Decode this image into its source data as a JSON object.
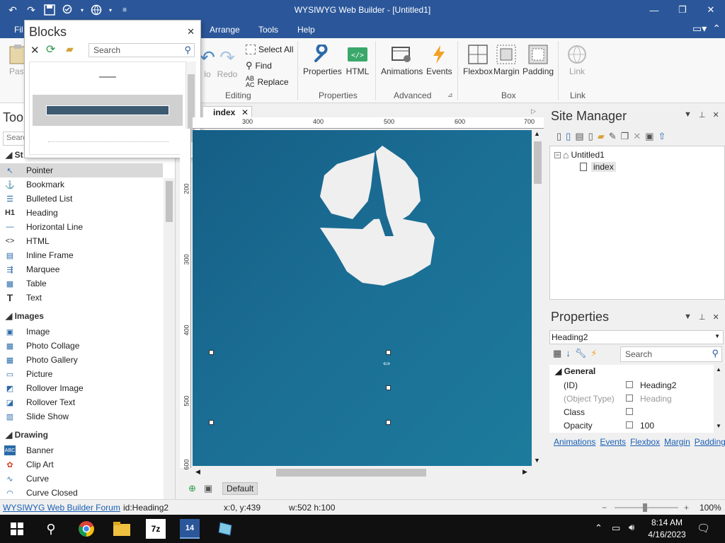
{
  "window": {
    "title": "WYSIWYG Web Builder - [Untitled1]",
    "qat_icons": [
      "undo-icon",
      "redo-icon",
      "save-icon",
      "preview-icon",
      "publish-icon",
      "customize-icon"
    ]
  },
  "menu": {
    "file_partial": "Fil",
    "arrange": "Arrange",
    "tools": "Tools",
    "help": "Help"
  },
  "ribbon": {
    "paste_partial": "Past",
    "undo_partial": "lo",
    "redo": "Redo",
    "select_all": "Select All",
    "find": "Find",
    "replace": "Replace",
    "editing_group": "Editing",
    "properties": "Properties",
    "html": "HTML",
    "properties_group": "Properties",
    "animations": "Animations",
    "events": "Events",
    "advanced_group": "Advanced",
    "flexbox": "Flexbox",
    "margin": "Margin",
    "padding": "Padding",
    "box_group": "Box",
    "link": "Link",
    "link_group": "Link"
  },
  "blocks": {
    "title": "Blocks",
    "search_placeholder": "Search"
  },
  "toolbox": {
    "title_partial": "Too",
    "search_partial": "Searc",
    "standard_partial": "St",
    "items_standard": [
      {
        "label": "Pointer",
        "icon": "pointer-icon"
      },
      {
        "label": "Bookmark",
        "icon": "anchor-icon"
      },
      {
        "label": "Bulleted List",
        "icon": "list-icon"
      },
      {
        "label": "Heading",
        "icon": "heading-icon"
      },
      {
        "label": "Horizontal Line",
        "icon": "line-icon"
      },
      {
        "label": "HTML",
        "icon": "code-icon"
      },
      {
        "label": "Inline Frame",
        "icon": "frame-icon"
      },
      {
        "label": "Marquee",
        "icon": "marquee-icon"
      },
      {
        "label": "Table",
        "icon": "table-icon"
      },
      {
        "label": "Text",
        "icon": "text-icon"
      }
    ],
    "images_label": "Images",
    "items_images": [
      {
        "label": "Image",
        "icon": "image-icon"
      },
      {
        "label": "Photo Collage",
        "icon": "collage-icon"
      },
      {
        "label": "Photo Gallery",
        "icon": "gallery-icon"
      },
      {
        "label": "Picture",
        "icon": "picture-icon"
      },
      {
        "label": "Rollover Image",
        "icon": "rollover-image-icon"
      },
      {
        "label": "Rollover Text",
        "icon": "rollover-text-icon"
      },
      {
        "label": "Slide Show",
        "icon": "slideshow-icon"
      }
    ],
    "drawing_label": "Drawing",
    "items_drawing": [
      {
        "label": "Banner",
        "icon": "banner-icon"
      },
      {
        "label": "Clip Art",
        "icon": "clipart-icon"
      },
      {
        "label": "Curve",
        "icon": "curve-icon"
      },
      {
        "label": "Curve Closed",
        "icon": "curve-closed-icon"
      }
    ]
  },
  "document": {
    "tab": "index",
    "ruler_h": [
      "300",
      "400",
      "500",
      "600",
      "700"
    ],
    "ruler_v": [
      "200",
      "300",
      "400",
      "500",
      "600"
    ],
    "layout_label": "Default"
  },
  "site_manager": {
    "title": "Site Manager",
    "root": "Untitled1",
    "page": "index"
  },
  "properties": {
    "title": "Properties",
    "selected": "Heading2",
    "search_placeholder": "Search",
    "category": "General",
    "rows": [
      {
        "key": "(ID)",
        "value": "Heading2"
      },
      {
        "key": "(Object Type)",
        "value": "Heading"
      },
      {
        "key": "Class",
        "value": ""
      },
      {
        "key": "Opacity",
        "value": "100"
      }
    ],
    "links": [
      "Animations",
      "Events",
      "Flexbox",
      "Margin",
      "Padding"
    ]
  },
  "statusbar": {
    "forum": "WYSIWYG Web Builder Forum",
    "id": "id:Heading2",
    "coords": "x:0, y:439",
    "size": "w:502 h:100",
    "zoom": "100%"
  },
  "taskbar": {
    "time": "8:14 AM",
    "date": "4/16/2023"
  },
  "colors": {
    "brand_blue": "#2b579a",
    "canvas_blue": "#1b6f95"
  }
}
